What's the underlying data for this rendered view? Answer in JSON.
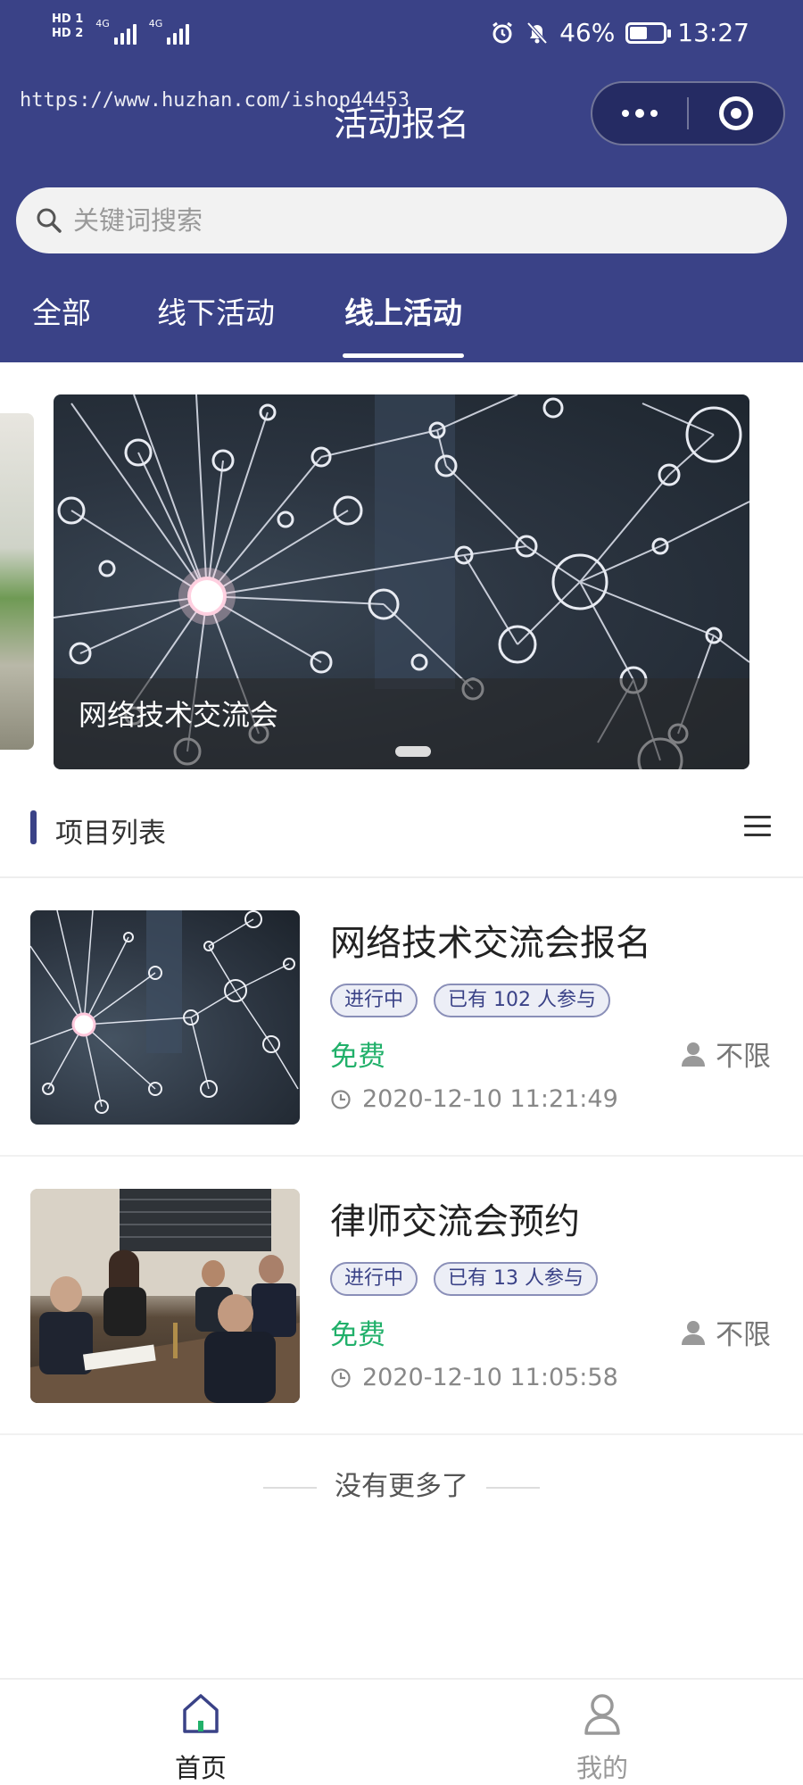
{
  "status_bar": {
    "sim1": "HD 1",
    "sim2": "HD 2",
    "network1": "4G",
    "network2": "4G",
    "battery": "46%",
    "battery_level": 0.46,
    "time": "13:27"
  },
  "watermark": "https://www.huzhan.com/ishop44453",
  "header": {
    "title": "活动报名",
    "more_icon": "more-dots-icon",
    "close_icon": "target-circle-icon"
  },
  "search": {
    "placeholder": "关键词搜索",
    "value": ""
  },
  "tabs": [
    {
      "label": "全部",
      "active": false
    },
    {
      "label": "线下活动",
      "active": false
    },
    {
      "label": "线上活动",
      "active": true
    }
  ],
  "banner": {
    "caption": "网络技术交流会",
    "slide_count": 1,
    "active_slide": 0
  },
  "section": {
    "title": "项目列表"
  },
  "activities": [
    {
      "title": "网络技术交流会报名",
      "status": "进行中",
      "participants": "已有 102 人参与",
      "price": "免费",
      "limit": "不限",
      "datetime": "2020-12-10 11:21:49"
    },
    {
      "title": "律师交流会预约",
      "status": "进行中",
      "participants": "已有 13 人参与",
      "price": "免费",
      "limit": "不限",
      "datetime": "2020-12-10 11:05:58"
    }
  ],
  "footer_text": "没有更多了",
  "tabbar": [
    {
      "label": "首页",
      "icon": "home-icon",
      "active": true
    },
    {
      "label": "我的",
      "icon": "user-icon",
      "active": false
    }
  ],
  "colors": {
    "header_bg": "#3a4287",
    "accent": "#3a4287",
    "price_green": "#21b06a"
  }
}
